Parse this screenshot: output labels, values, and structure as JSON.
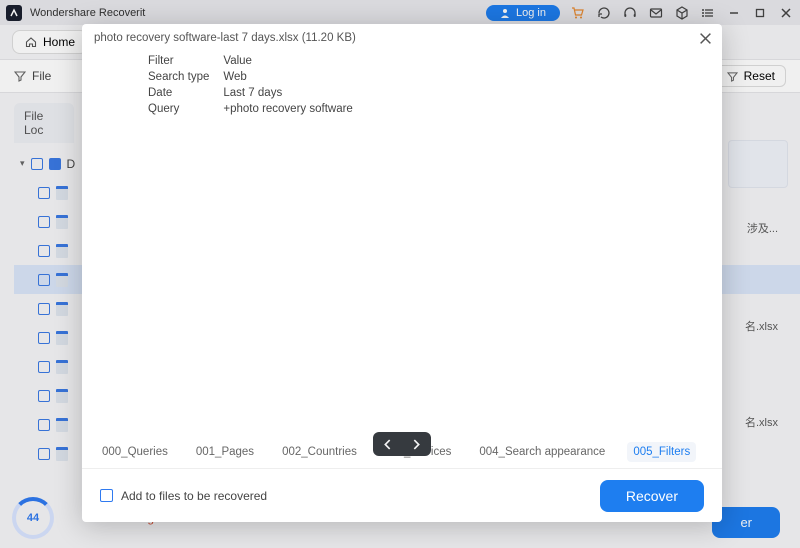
{
  "window": {
    "title": "Wondershare Recoverit",
    "login_label": "Log in"
  },
  "home": {
    "label": "Home"
  },
  "filter_bar": {
    "file_label": "File",
    "reset_label": "Reset"
  },
  "tree": {
    "header": "File Loc",
    "root_label": "D"
  },
  "files": {
    "label1": "涉及...",
    "label2": "名.xlsx",
    "label3": "名.xlsx"
  },
  "status": {
    "percent": "44",
    "text": "Scanning Paused.",
    "btn": "er"
  },
  "modal": {
    "title": "photo recovery software-last 7 days.xlsx (11.20 KB)",
    "header_filter": "Filter",
    "header_value": "Value",
    "row1_k": "Search type",
    "row1_v": "Web",
    "row2_k": "Date",
    "row2_v": "Last 7 days",
    "row3_k": "Query",
    "row3_v": "+photo recovery software",
    "tabs": [
      "000_Queries",
      "001_Pages",
      "002_Countries",
      "003_Devices",
      "004_Search appearance",
      "005_Filters"
    ],
    "add_label": "Add to files to be recovered",
    "recover_label": "Recover"
  }
}
